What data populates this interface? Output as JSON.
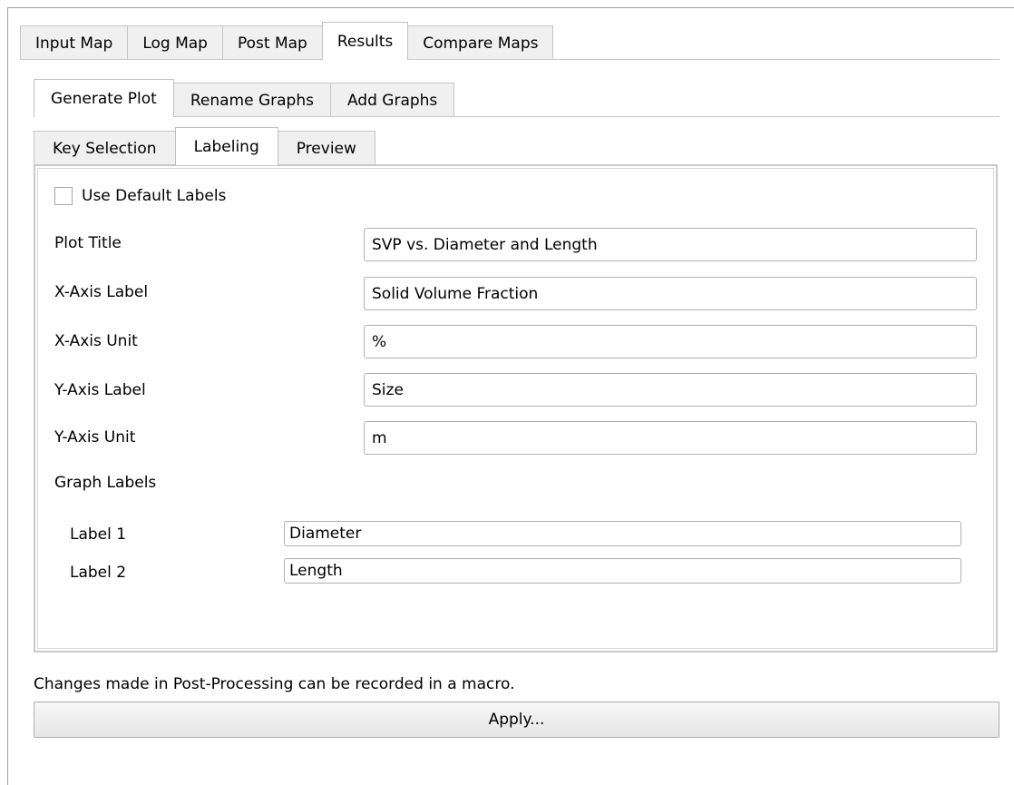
{
  "main_tabs": [
    {
      "label": "Input Map",
      "active": false
    },
    {
      "label": "Log Map",
      "active": false
    },
    {
      "label": "Post Map",
      "active": false
    },
    {
      "label": "Results",
      "active": true
    },
    {
      "label": "Compare Maps",
      "active": false
    }
  ],
  "sub_tabs": [
    {
      "label": "Generate Plot",
      "active": true
    },
    {
      "label": "Rename Graphs",
      "active": false
    },
    {
      "label": "Add Graphs",
      "active": false
    }
  ],
  "inner_tabs": [
    {
      "label": "Key Selection",
      "active": false
    },
    {
      "label": "Labeling",
      "active": true
    },
    {
      "label": "Preview",
      "active": false
    }
  ],
  "labeling": {
    "use_default_labels": {
      "label": "Use Default Labels",
      "checked": false
    },
    "plot_title": {
      "label": "Plot Title",
      "value": "SVP vs. Diameter and Length"
    },
    "x_axis_label": {
      "label": "X-Axis Label",
      "value": "Solid Volume Fraction"
    },
    "x_axis_unit": {
      "label": "X-Axis Unit",
      "value": "%"
    },
    "y_axis_label": {
      "label": "Y-Axis Label",
      "value": "Size"
    },
    "y_axis_unit": {
      "label": "Y-Axis Unit",
      "value": "m"
    },
    "graph_labels_heading": "Graph Labels",
    "graph_labels": [
      {
        "label": "Label 1",
        "value": "Diameter"
      },
      {
        "label": "Label 2",
        "value": "Length"
      }
    ]
  },
  "footer": {
    "note": "Changes made in Post-Processing can be recorded in a macro.",
    "apply_label": "Apply..."
  },
  "colors": {
    "tab_inactive": "#f0f0f0",
    "tab_active": "#ffffff",
    "border": "#c6c6c6"
  }
}
